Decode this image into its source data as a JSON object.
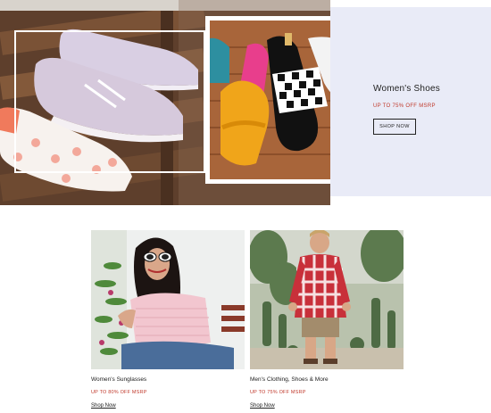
{
  "hero": {
    "title": "Women's Shoes",
    "offer": "UP TO 75% OFF MSRP",
    "cta_label": "SHOP NOW"
  },
  "cards": [
    {
      "title": "Women's Sunglasses",
      "offer": "UP TO 80% OFF MSRP",
      "link_label": "Shop Now"
    },
    {
      "title": "Men's Clothing, Shoes & More",
      "offer": "UP TO 75% OFF MSRP",
      "link_label": "Shop Now"
    }
  ],
  "colors": {
    "accent_red": "#c0392b",
    "panel_bg": "#e9ebf7",
    "text": "#222222"
  }
}
